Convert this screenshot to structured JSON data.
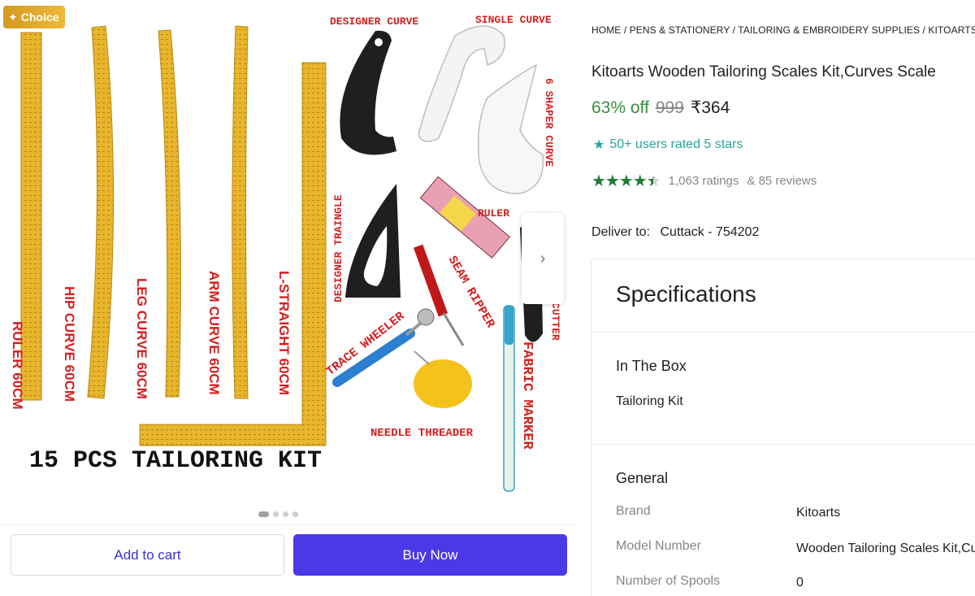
{
  "badge": {
    "label": "Choice",
    "icon": "sparkle-icon"
  },
  "image": {
    "labels": {
      "ruler": "RULER 60CM",
      "hip_curve": "HIP CURVE 60CM",
      "leg_curve": "LEG CURVE 60CM",
      "arm_curve": "ARM CURVE 60CM",
      "l_straight": "L-STRAIGHT 60CM",
      "designer_curve": "DESIGNER CURVE",
      "single_curve": "SINGLE CURVE",
      "shaper_curve": "6 SHAPER CURVE",
      "designer_triangle": "DESIGNER TRAINGLE",
      "tape_ruler": "RULER",
      "seam_ripper": "SEAM RIPPER",
      "trace_wheeler": "TRACE WHEELER",
      "cutter": "CUTTER",
      "needle_threader": "NEEDLE THREADER",
      "fabric_marker": "FABRIC MARKER",
      "kit_caption": "15 PCS TAILORING KIT",
      "brand_mark": "Kitoarts"
    },
    "carousel": {
      "total": 4,
      "active": 1
    }
  },
  "actions": {
    "add_to_cart": "Add to cart",
    "buy_now": "Buy Now"
  },
  "product": {
    "breadcrumb": "HOME / PENS & STATIONERY / TAILORING & EMBROIDERY SUPPLIES / KITOARTS",
    "title": "Kitoarts Wooden Tailoring Scales Kit,Curves Scale",
    "discount": "63% off",
    "mrp": "999",
    "price": "₹364",
    "rated_users": "50+ users rated 5 stars",
    "rating_value": 4.5,
    "ratings_count": "1,063 ratings",
    "reviews_count": "& 85 reviews",
    "deliver_label": "Deliver to:",
    "deliver_location": "Cuttack - 754202"
  },
  "specifications": {
    "heading": "Specifications",
    "in_the_box": {
      "heading": "In The Box",
      "value": "Tailoring Kit"
    },
    "general": {
      "heading": "General",
      "rows": [
        {
          "key": "Brand",
          "value": "Kitoarts"
        },
        {
          "key": "Model Number",
          "value": "Wooden Tailoring Scales Kit,Curves Scale"
        },
        {
          "key": "Number of Spools",
          "value": "0"
        }
      ]
    }
  },
  "colors": {
    "discount_green": "#388e3c",
    "rating_star_green": "#1f7a35",
    "teal_highlight": "#26a69a",
    "buy_now_bg": "#4b38e6",
    "add_to_cart_text": "#3b2fd9",
    "label_red": "#d42020",
    "wood_yellow": "#e8b52b"
  }
}
